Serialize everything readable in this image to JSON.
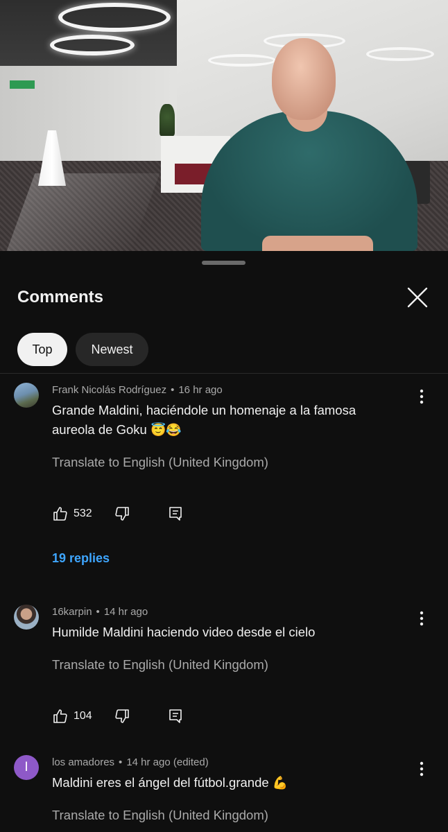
{
  "sheet": {
    "title": "Comments",
    "sort_chips": [
      "Top",
      "Newest"
    ],
    "selected_sort": "Top"
  },
  "comments": [
    {
      "author": "Frank Nicolás Rodríguez",
      "time": "16 hr ago",
      "text": "Grande Maldini, haciéndole un homenaje a la famosa aureola de Goku",
      "emoji": "😇😂",
      "translate": "Translate to English (United Kingdom)",
      "likes": "532",
      "replies": "19 replies"
    },
    {
      "author": "16karpin",
      "time": "14 hr ago",
      "text": "Humilde Maldini haciendo video desde el cielo",
      "emoji": "",
      "translate": "Translate to English (United Kingdom)",
      "likes": "104"
    },
    {
      "author": "los amadores",
      "time": "14 hr ago (edited)",
      "text": "Maldini eres el ángel del fútbol.grande",
      "emoji": "💪",
      "translate": "Translate to English (United Kingdom)",
      "avatar_letter": "I",
      "avatar_color": "#8e59c8"
    }
  ],
  "separator": "•",
  "colors": {
    "background": "#0f0f0f",
    "link": "#3ea6ff",
    "secondary_text": "#aaaaaa"
  }
}
